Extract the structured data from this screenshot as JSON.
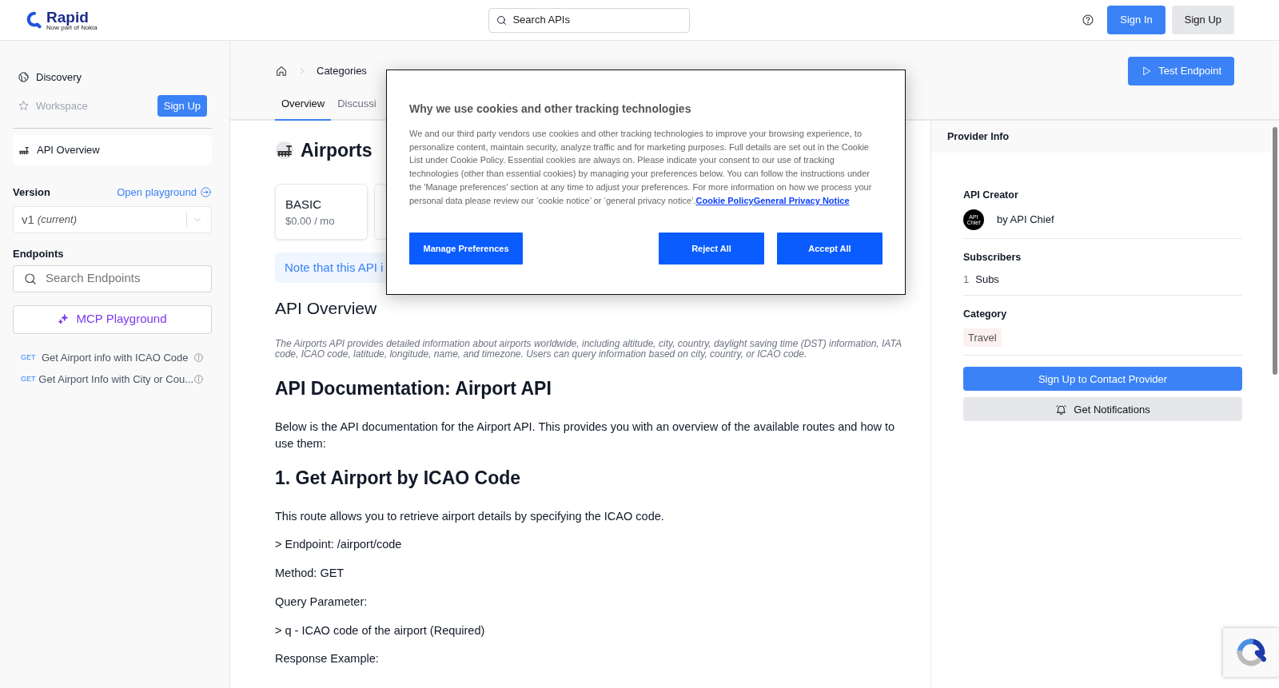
{
  "header": {
    "logo": {
      "name": "Rapid",
      "tagline": "Now part of Nokia"
    },
    "search": {
      "placeholder": "Search APIs"
    },
    "buttons": [
      {
        "label": "Sign In",
        "kind": "primary"
      },
      {
        "label": "Sign Up",
        "kind": "secondary"
      }
    ]
  },
  "sidebar": {
    "nav": [
      {
        "label": "Discovery",
        "disabled": false
      },
      {
        "label": "Workspace",
        "disabled": true
      }
    ],
    "signup_button": "Sign Up",
    "overview_item": {
      "label": "API Overview",
      "selected": true
    },
    "version": {
      "label": "Version",
      "link": "Open playground",
      "value": "v1",
      "note": "(current)"
    },
    "endpoints": {
      "label": "Endpoints",
      "placeholder": "Search Endpoints",
      "mcp_button": "MCP Playground",
      "items": [
        {
          "method": "GET",
          "name": "Get Airport info with ICAO Code"
        },
        {
          "method": "GET",
          "name": "Get Airport Info with City or Cou..."
        }
      ]
    }
  },
  "main": {
    "breadcrumb": [
      "Categories"
    ],
    "test_button": "Test Endpoint",
    "tabs": [
      {
        "label": "Overview",
        "selected": true
      },
      {
        "label": "Discussi",
        "selected": false
      }
    ],
    "title": "Airports",
    "plans": [
      {
        "name": "BASIC",
        "price": "$0.00 / mo"
      }
    ],
    "note": "Note that this API i",
    "content": [
      {
        "kind": "h2",
        "text": "API Overview"
      },
      {
        "kind": "desc",
        "text": "The Airports API provides detailed information about airports worldwide, including altitude, city, country, daylight saving time (DST) information, IATA code, ICAO code, latitude, longitude, name, and timezone. Users can query information based on city, country, or ICAO code."
      },
      {
        "kind": "h1",
        "text": "API Documentation: Airport API"
      },
      {
        "kind": "p",
        "text": "Below is the API documentation for the Airport API. This provides you with an overview of the available routes and how to use them:"
      },
      {
        "kind": "h1",
        "text": "1. Get Airport by ICAO Code"
      },
      {
        "kind": "p",
        "text": "This route allows you to retrieve airport details by specifying the ICAO code."
      },
      {
        "kind": "p",
        "text": "> Endpoint: /airport/code"
      },
      {
        "kind": "p",
        "text": "Method: GET"
      },
      {
        "kind": "p",
        "text": "Query Parameter:"
      },
      {
        "kind": "p",
        "text": "> q - ICAO code of the airport (Required)"
      },
      {
        "kind": "p",
        "text": "Response Example:"
      }
    ]
  },
  "provider": {
    "title": "Provider Info",
    "creator_label": "API Creator",
    "avatar_text": "API Chief",
    "creator": "by API Chief",
    "subscribers_label": "Subscribers",
    "subscribers_count": "1",
    "subscribers_unit": "Subs",
    "category_label": "Category",
    "category": "Travel",
    "contact_button": "Sign Up to Contact Provider",
    "notify_button": "Get Notifications"
  },
  "cookie_dialog": {
    "title": "Why we use cookies and other tracking technologies",
    "body": "We and our third party vendors use cookies and other tracking technologies to improve your browsing experience, to personalize content, maintain security, analyze traffic and for marketing purposes. Full details are set out in the Cookie List under Cookie Policy. Essential cookies are always on. Please indicate your consent to our use of tracking technologies (other than essential cookies) by managing your preferences below. You can follow the instructions under the 'Manage preferences' section at any time to adjust your preferences. For more information on how we process your personal data please review our ‘cookie notice’ or ‘general privacy notice’.",
    "links": [
      "Cookie Policy",
      "General Privacy Notice"
    ],
    "buttons": [
      {
        "label": "Manage Preferences"
      },
      {
        "label": "Reject All"
      },
      {
        "label": "Accept All"
      }
    ]
  }
}
